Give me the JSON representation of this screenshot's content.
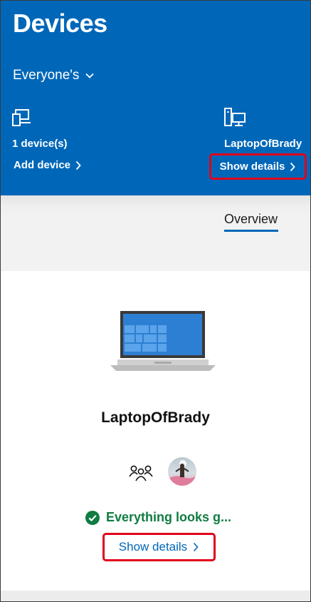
{
  "header": {
    "title": "Devices",
    "filter_label": "Everyone's",
    "device_count": "1 device(s)",
    "add_device_label": "Add device",
    "device_name": "LaptopOfBrady",
    "show_details_label": "Show details"
  },
  "tabs": [
    {
      "label": "Overview",
      "selected": true
    }
  ],
  "device_card": {
    "name": "LaptopOfBrady",
    "status": "Everything looks g...",
    "status_color": "#107c41",
    "show_details_label": "Show details"
  },
  "colors": {
    "accent": "#0067b8",
    "highlight_box": "#e0001b"
  },
  "icons": [
    "devices-icon",
    "chevron-down-icon",
    "desktop-pc-icon",
    "chevron-right-icon",
    "laptop-icon",
    "family-icon",
    "user-avatar",
    "check-circle-icon"
  ]
}
